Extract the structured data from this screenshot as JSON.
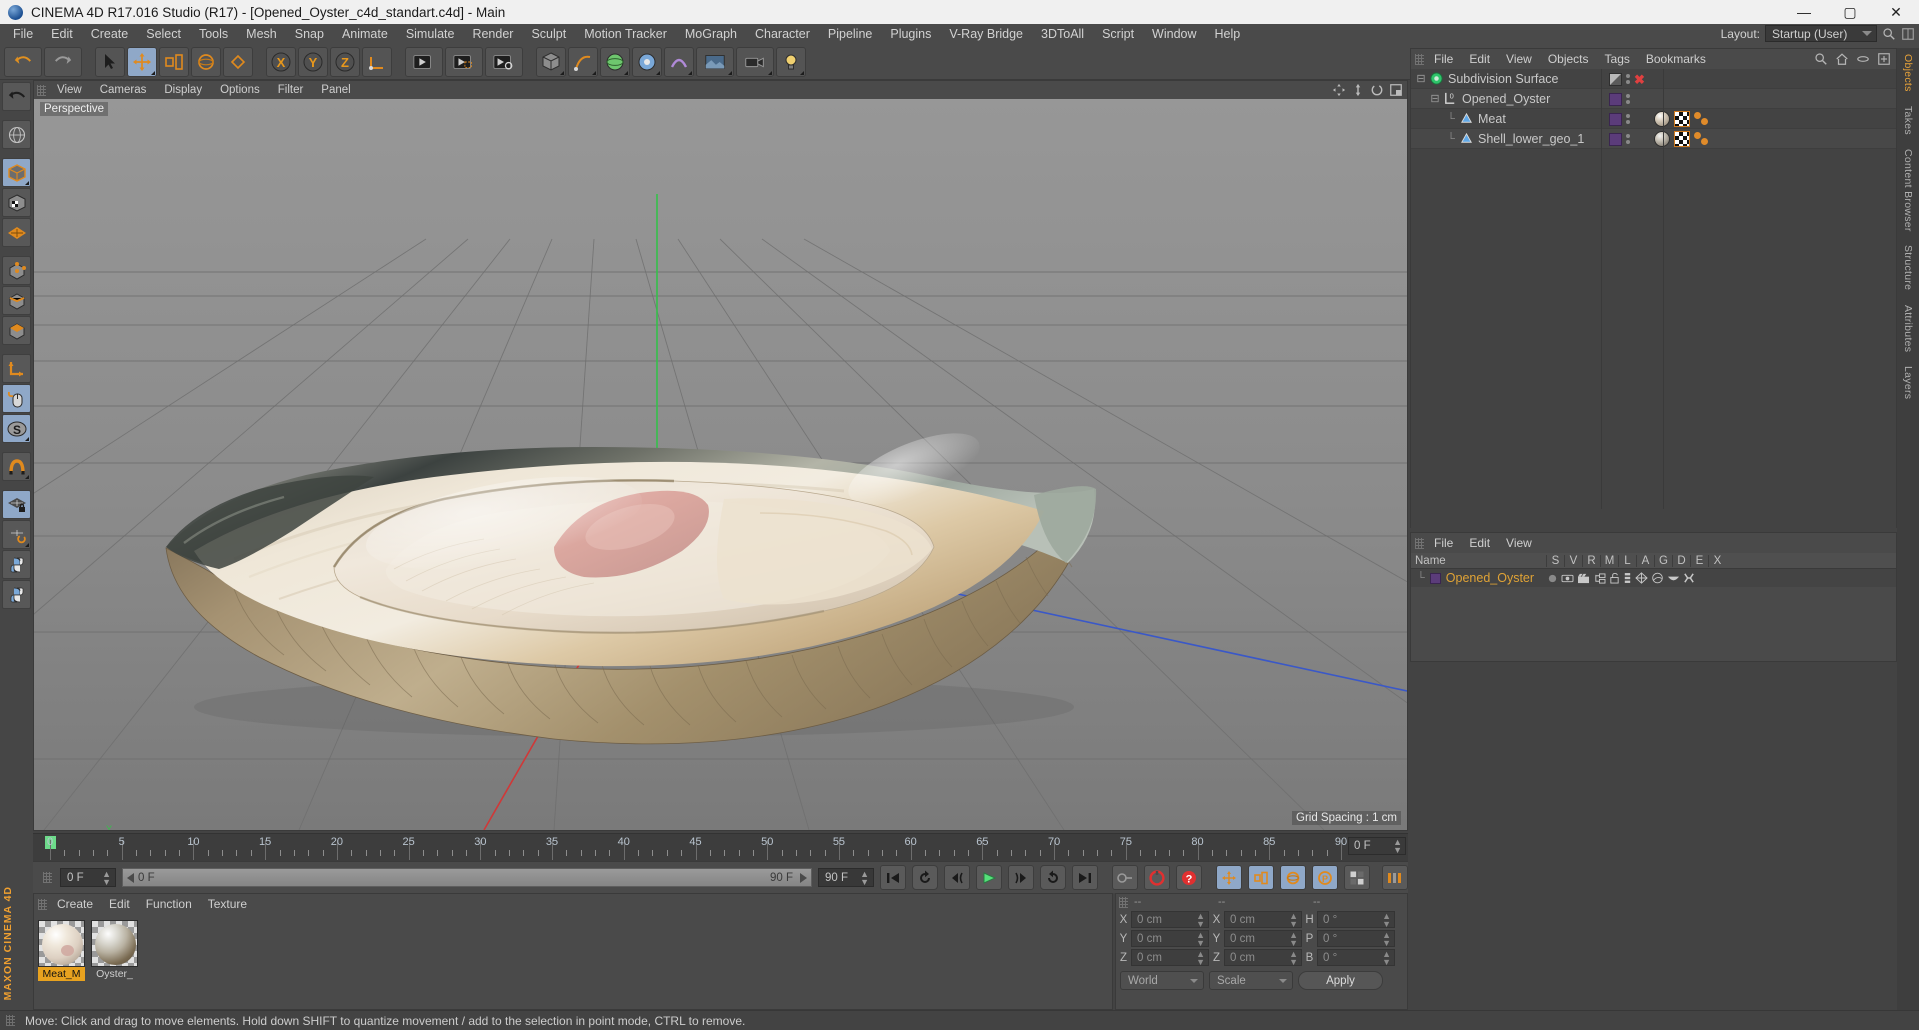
{
  "window": {
    "title": "CINEMA 4D R17.016 Studio (R17) - [Opened_Oyster_c4d_standart.c4d] - Main",
    "minimize": "—",
    "maximize": "▢",
    "close": "✕"
  },
  "menubar": {
    "items": [
      "File",
      "Edit",
      "Create",
      "Select",
      "Tools",
      "Mesh",
      "Snap",
      "Animate",
      "Simulate",
      "Render",
      "Sculpt",
      "Motion Tracker",
      "MoGraph",
      "Character",
      "Pipeline",
      "Plugins",
      "V-Ray Bridge",
      "3DToAll",
      "Script",
      "Window",
      "Help"
    ],
    "layout_label": "Layout:",
    "layout_value": "Startup (User)",
    "search_icon": "search-icon"
  },
  "toolbar": {
    "buttons": [
      {
        "name": "undo-button",
        "icon": "undo-arrow-icon"
      },
      {
        "name": "redo-button",
        "icon": "redo-arrow-icon"
      },
      {
        "name": "live-selection-button",
        "icon": "cursor-arrow-icon"
      },
      {
        "name": "move-button",
        "icon": "move-axis-icon",
        "active": true
      },
      {
        "name": "scale-button",
        "icon": "scale-icon"
      },
      {
        "name": "rotate-button",
        "icon": "rotate-icon"
      },
      {
        "name": "drag-button",
        "icon": "drag-icon"
      },
      {
        "name": "x-axis-button",
        "icon": "x-axis-icon",
        "label": "X"
      },
      {
        "name": "y-axis-button",
        "icon": "y-axis-icon",
        "label": "Y"
      },
      {
        "name": "z-axis-button",
        "icon": "z-axis-icon",
        "label": "Z"
      },
      {
        "name": "world-coord-button",
        "icon": "world-axis-icon"
      },
      {
        "name": "render-view-button",
        "icon": "render-view-icon"
      },
      {
        "name": "render-region-button",
        "icon": "render-region-icon"
      },
      {
        "name": "render-settings-button",
        "icon": "render-settings-icon"
      },
      {
        "name": "cube-primitive-button",
        "icon": "cube-icon"
      },
      {
        "name": "spline-pen-button",
        "icon": "pen-icon"
      },
      {
        "name": "nurbs-button",
        "icon": "nurbs-icon"
      },
      {
        "name": "array-button",
        "icon": "array-icon"
      },
      {
        "name": "deformer-button",
        "icon": "deformer-icon"
      },
      {
        "name": "environment-button",
        "icon": "environment-icon"
      },
      {
        "name": "camera-button",
        "icon": "camera-icon"
      },
      {
        "name": "light-button",
        "icon": "light-bulb-icon"
      }
    ]
  },
  "leftdock": {
    "buttons": [
      {
        "name": "undo-tool",
        "icon": "undo-arrow-icon"
      },
      {
        "name": "make-editable-tool",
        "icon": "globe-mesh-icon"
      },
      {
        "name": "model-mode-tool",
        "icon": "cube-solid-icon",
        "selected": true
      },
      {
        "name": "texture-mode-tool",
        "icon": "cube-checker-icon"
      },
      {
        "name": "polygon-grid-tool",
        "icon": "orange-grid-icon"
      },
      {
        "name": "point-mode-tool",
        "icon": "cube-points-icon"
      },
      {
        "name": "edge-mode-tool",
        "icon": "cube-edge-icon"
      },
      {
        "name": "polygon-mode-tool",
        "icon": "cube-face-icon"
      },
      {
        "name": "axis-mode-tool",
        "icon": "axis-l-icon"
      },
      {
        "name": "viewport-solo-tool",
        "icon": "mouse-icon",
        "selected": true
      },
      {
        "name": "enable-axis-tool",
        "icon": "s-disc-icon",
        "selected": true
      },
      {
        "name": "snap-tool",
        "icon": "magnet-icon"
      },
      {
        "name": "workplane-lock-tool",
        "icon": "grid-lock-icon",
        "selected": true
      },
      {
        "name": "workplane-rotate-tool",
        "icon": "grid-rotate-icon"
      },
      {
        "name": "python-tool-1",
        "icon": "python-icon"
      },
      {
        "name": "python-tool-2",
        "icon": "python-icon"
      }
    ],
    "brand": "MAXON CINEMA 4D"
  },
  "viewport": {
    "menu": [
      "View",
      "Cameras",
      "Display",
      "Options",
      "Filter",
      "Panel"
    ],
    "label": "Perspective",
    "grid_spacing": "Grid Spacing : 1 cm",
    "corner_icons": [
      "pan-view-icon",
      "zoom-view-icon",
      "rotate-view-icon",
      "maximize-view-icon"
    ]
  },
  "object_manager": {
    "menu": [
      "File",
      "Edit",
      "View",
      "Objects",
      "Tags",
      "Bookmarks"
    ],
    "right_icons": [
      "search-icon",
      "home-icon",
      "ellipse-icon",
      "expand-icon"
    ],
    "objects": [
      {
        "name": "Subdivision Surface",
        "type": "generator",
        "indent": 0,
        "tags": [
          "grey-swatch",
          "two-dots",
          "red-x"
        ]
      },
      {
        "name": "Opened_Oyster",
        "type": "null",
        "indent": 1,
        "tags": [
          "purple-swatch",
          "two-dots"
        ]
      },
      {
        "name": "Meat",
        "type": "polygon",
        "indent": 2,
        "tags": [
          "purple-swatch",
          "two-dots",
          "material-meat",
          "uvw-checker",
          "phong"
        ]
      },
      {
        "name": "Shell_lower_geo_1",
        "type": "polygon",
        "indent": 2,
        "tags": [
          "purple-swatch",
          "two-dots",
          "material-shell",
          "uvw-checker",
          "phong"
        ]
      }
    ]
  },
  "right_tabs": [
    {
      "label": "Objects",
      "active": true
    },
    {
      "label": "Takes",
      "active": false
    },
    {
      "label": "Content Browser",
      "active": false
    },
    {
      "label": "Structure",
      "active": false
    },
    {
      "label": "Attributes",
      "active": false
    },
    {
      "label": "Layers",
      "active": false
    }
  ],
  "attribute_manager": {
    "menu": [
      "File",
      "Edit",
      "View"
    ],
    "columns": [
      "Name",
      "S",
      "V",
      "R",
      "M",
      "L",
      "A",
      "G",
      "D",
      "E",
      "X"
    ],
    "rows": [
      {
        "name": "Opened_Oyster",
        "color": "#5b3c7a",
        "icons": [
          "dot-icon",
          "eye-icon",
          "clapper-icon",
          "hierarchy-icon",
          "unlock-icon",
          "list-icon",
          "deform-icon",
          "shade-icon",
          "cap-icon",
          "bone-icon"
        ]
      }
    ]
  },
  "timeline": {
    "ticks": [
      0,
      5,
      10,
      15,
      20,
      25,
      30,
      35,
      40,
      45,
      50,
      55,
      60,
      65,
      70,
      75,
      80,
      85,
      90
    ],
    "min": 0,
    "max": 90,
    "current_frame_field": "0 F"
  },
  "playback": {
    "current_frame": "0 F",
    "scrubber_left": "0 F",
    "scrubber_right": "90 F",
    "end_frame": "90 F",
    "buttons": [
      {
        "name": "go-to-start-button",
        "icon": "skip-start-icon"
      },
      {
        "name": "previous-key-button",
        "icon": "prev-key-icon"
      },
      {
        "name": "step-back-button",
        "icon": "step-back-icon"
      },
      {
        "name": "play-button",
        "icon": "play-icon"
      },
      {
        "name": "step-forward-button",
        "icon": "step-forward-icon"
      },
      {
        "name": "next-key-button",
        "icon": "next-key-icon"
      },
      {
        "name": "go-to-end-button",
        "icon": "skip-end-icon"
      },
      {
        "name": "autokey-button",
        "icon": "key-icon"
      },
      {
        "name": "record-button",
        "icon": "record-circle-icon"
      },
      {
        "name": "help-button",
        "icon": "question-icon"
      },
      {
        "name": "record-position-button",
        "icon": "position-key-icon"
      },
      {
        "name": "record-scale-button",
        "icon": "scale-key-icon"
      },
      {
        "name": "record-rotation-button",
        "icon": "rotation-key-icon"
      },
      {
        "name": "record-param-button",
        "icon": "param-key-icon"
      },
      {
        "name": "record-pla-button",
        "icon": "pla-key-icon"
      },
      {
        "name": "keyframe-selection-button",
        "icon": "keyframe-select-icon"
      },
      {
        "name": "timeline-settings-button",
        "icon": "timeline-settings-icon"
      }
    ]
  },
  "material_manager": {
    "menu": [
      "Create",
      "Edit",
      "Function",
      "Texture"
    ],
    "materials": [
      {
        "label": "Meat_M",
        "selected": true,
        "swatch": "#ddd0c2"
      },
      {
        "label": "Oyster_",
        "selected": false,
        "swatch": "#c9c5b8"
      }
    ]
  },
  "coordinates": {
    "headers": [
      "--",
      "--",
      "--"
    ],
    "rows": [
      {
        "axis1": "X",
        "val1": "0 cm",
        "axis2": "X",
        "val2": "0 cm",
        "axis3": "H",
        "val3": "0 °"
      },
      {
        "axis1": "Y",
        "val1": "0 cm",
        "axis2": "Y",
        "val2": "0 cm",
        "axis3": "P",
        "val3": "0 °"
      },
      {
        "axis1": "Z",
        "val1": "0 cm",
        "axis2": "Z",
        "val2": "0 cm",
        "axis3": "B",
        "val3": "0 °"
      }
    ],
    "world_select": "World",
    "scale_select": "Scale",
    "apply_label": "Apply"
  },
  "statusbar": {
    "message": "Move: Click and drag to move elements. Hold down SHIFT to quantize movement / add to the selection in point mode, CTRL to remove."
  },
  "colors": {
    "accent_orange": "#e8a21f",
    "selection_blue": "#8fa8c8",
    "tag_purple": "#5b3c7a",
    "play_green": "#6ddb8a",
    "record_red": "#e03030"
  }
}
